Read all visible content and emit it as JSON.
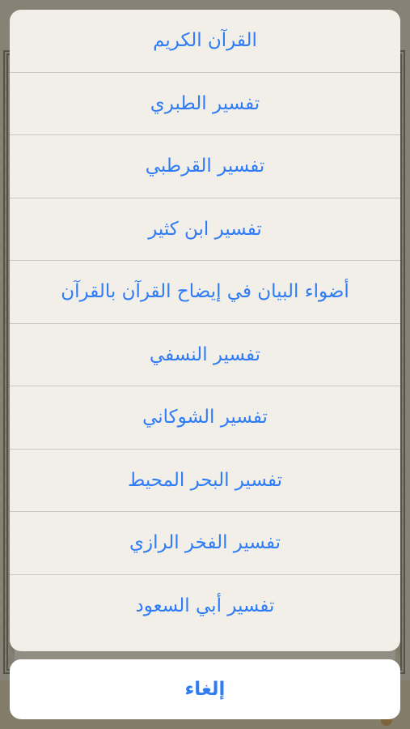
{
  "action_sheet": {
    "items": [
      {
        "label": "القرآن الكريم"
      },
      {
        "label": "تفسير الطبري"
      },
      {
        "label": "تفسير القرطبي"
      },
      {
        "label": "تفسير ابن كثير"
      },
      {
        "label": "أضواء البيان في إيضاح القرآن بالقرآن"
      },
      {
        "label": "تفسير النسفي"
      },
      {
        "label": "تفسير الشوكاني"
      },
      {
        "label": "تفسير البحر المحيط"
      },
      {
        "label": "تفسير الفخر الرازي"
      },
      {
        "label": "تفسير أبي السعود"
      }
    ],
    "cancel_label": "إلغاء"
  },
  "colors": {
    "accent": "#2f7cf6",
    "sheet_background": "#f1efe7",
    "cancel_background": "#ffffff"
  }
}
